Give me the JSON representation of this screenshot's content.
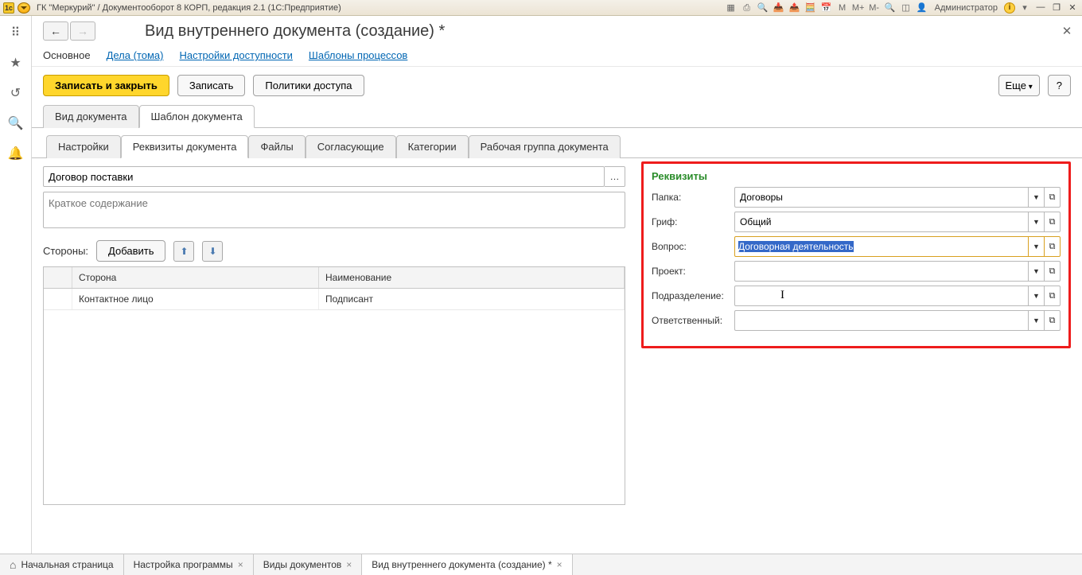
{
  "titlebar": {
    "title": "ГК \"Меркурий\" / Документооборот 8 КОРП, редакция 2.1  (1С:Предприятие)",
    "user": "Администратор",
    "m_labels": [
      "M",
      "M+",
      "M-"
    ]
  },
  "page": {
    "title": "Вид внутреннего документа (создание) *"
  },
  "top_nav": {
    "items": [
      "Основное",
      "Дела (тома)",
      "Настройки доступности",
      "Шаблоны процессов"
    ],
    "active_index": 0
  },
  "commands": {
    "save_close": "Записать и закрыть",
    "save": "Записать",
    "policies": "Политики доступа",
    "more": "Еще",
    "help": "?"
  },
  "main_tabs": {
    "items": [
      "Вид документа",
      "Шаблон документа"
    ],
    "active_index": 1
  },
  "sub_tabs": {
    "items": [
      "Настройки",
      "Реквизиты документа",
      "Файлы",
      "Согласующие",
      "Категории",
      "Рабочая группа документа"
    ],
    "active_index": 1
  },
  "doc": {
    "name": "Договор поставки",
    "brief_placeholder": "Краткое содержание",
    "brief": ""
  },
  "sides": {
    "label": "Стороны:",
    "add": "Добавить",
    "headers": [
      "",
      "Сторона",
      "Наименование"
    ],
    "rows": [
      [
        "",
        "Контактное лицо",
        "Подписант"
      ]
    ]
  },
  "requisites": {
    "title": "Реквизиты",
    "fields": [
      {
        "label": "Папка:",
        "value": "Договоры"
      },
      {
        "label": "Гриф:",
        "value": "Общий"
      },
      {
        "label": "Вопрос:",
        "value": "Договорная деятельность",
        "focused": true
      },
      {
        "label": "Проект:",
        "value": ""
      },
      {
        "label": "Подразделение:",
        "value": ""
      },
      {
        "label": "Ответственный:",
        "value": ""
      }
    ]
  },
  "taskbar": {
    "home": "Начальная страница",
    "tabs": [
      {
        "label": "Настройка программы",
        "close": true
      },
      {
        "label": "Виды документов",
        "close": true
      },
      {
        "label": "Вид внутреннего документа (создание) *",
        "close": true,
        "active": true
      }
    ]
  }
}
